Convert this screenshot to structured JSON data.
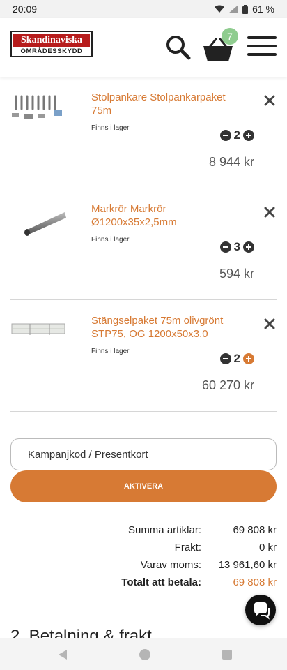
{
  "status_bar": {
    "time": "20:09",
    "battery": "61 %"
  },
  "header": {
    "logo_top": "Skandinaviska",
    "logo_bottom": "OMRÅDESSKYDD",
    "cart_count": "7"
  },
  "cart": {
    "items": [
      {
        "title": "Stolpankare Stolpankarpaket 75m",
        "stock": "Finns i lager",
        "qty": "2",
        "price": "8 944 kr"
      },
      {
        "title": "Markrör Markrör Ø1200x35x2,5mm",
        "stock": "Finns i lager",
        "qty": "3",
        "price": "594 kr"
      },
      {
        "title": "Stängselpaket 75m olivgrönt STP75, OG 1200x50x3,0",
        "stock": "Finns i lager",
        "qty": "2",
        "price": "60 270 kr"
      }
    ]
  },
  "coupon": {
    "placeholder": "Kampanjkod / Presentkort",
    "button_label": "AKTIVERA"
  },
  "summary": {
    "rows": [
      {
        "label": "Summa artiklar:",
        "value": "69 808 kr"
      },
      {
        "label": "Frakt:",
        "value": "0 kr"
      },
      {
        "label": "Varav moms:",
        "value": "13 961,60 kr"
      },
      {
        "label": "Totalt att betala:",
        "value": "69 808 kr"
      }
    ]
  },
  "next_section": {
    "title": "2. Betalning & frakt"
  },
  "colors": {
    "accent": "#d77a34",
    "badge": "#8fcc8f",
    "logo_red": "#b71c1c"
  }
}
